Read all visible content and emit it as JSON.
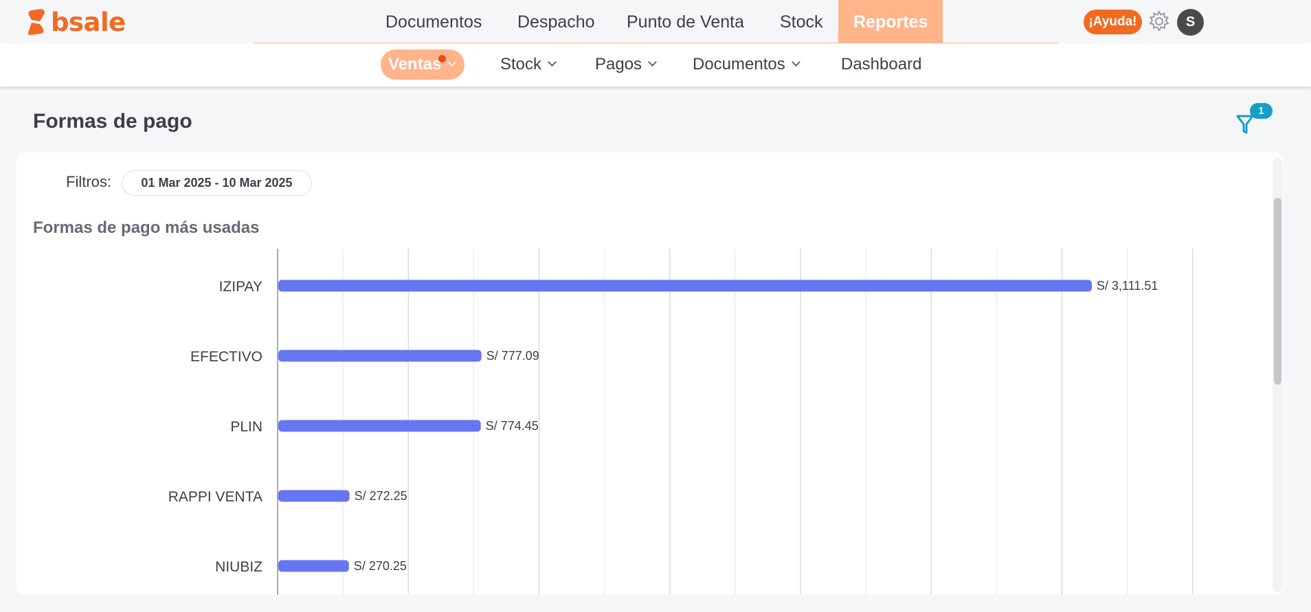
{
  "brand": {
    "logo_text": "bsale",
    "color": "#f26a21"
  },
  "main_nav": [
    {
      "label": "Documentos",
      "active": false
    },
    {
      "label": "Despacho",
      "active": false
    },
    {
      "label": "Punto de Venta",
      "active": false
    },
    {
      "label": "Stock",
      "active": false
    },
    {
      "label": "Reportes",
      "active": true
    }
  ],
  "header_actions": {
    "help_label": "¡Ayuda!",
    "settings_icon": "gear-icon",
    "avatar_initial": "S"
  },
  "sub_nav": [
    {
      "label": "Ventas",
      "active": true,
      "has_dropdown": true,
      "has_notification": true
    },
    {
      "label": "Stock",
      "active": false,
      "has_dropdown": true
    },
    {
      "label": "Pagos",
      "active": false,
      "has_dropdown": true
    },
    {
      "label": "Documentos",
      "active": false,
      "has_dropdown": true
    },
    {
      "label": "Dashboard",
      "active": false,
      "has_dropdown": false
    }
  ],
  "page": {
    "title": "Formas de pago",
    "filter_count": "1"
  },
  "filters": {
    "label": "Filtros:",
    "date_range": "01 Mar 2025 - 10 Mar 2025"
  },
  "chart_section": {
    "title": "Formas de pago más usadas"
  },
  "colors": {
    "bar": "#6675f0",
    "accent": "#ffb48a",
    "badge": "#159ec8"
  },
  "chart_data": {
    "type": "bar",
    "orientation": "horizontal",
    "title": "Formas de pago más usadas",
    "categories": [
      "IZIPAY",
      "EFECTIVO",
      "PLIN",
      "RAPPI VENTA",
      "NIUBIZ"
    ],
    "values": [
      3111.51,
      777.09,
      774.45,
      272.25,
      270.25
    ],
    "value_labels": [
      "S/ 3,111.51",
      "S/ 777.09",
      "S/ 774.45",
      "S/ 272.25",
      "S/ 270.25"
    ],
    "xlim": [
      0,
      3500
    ],
    "grid": true
  }
}
